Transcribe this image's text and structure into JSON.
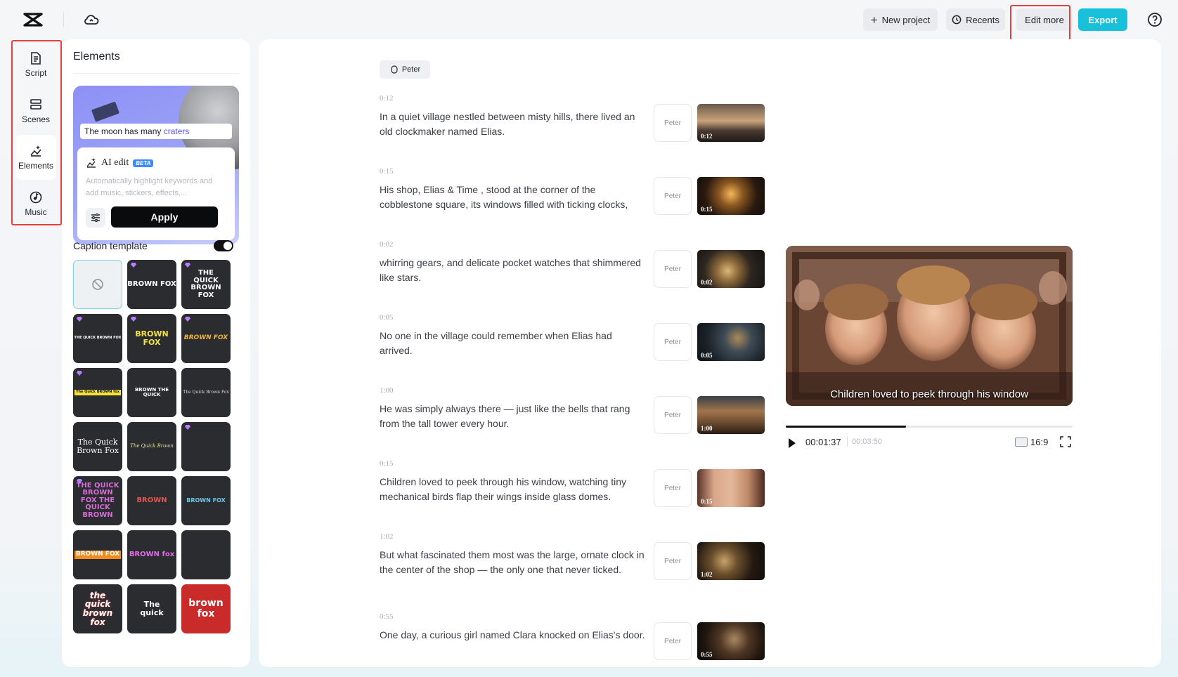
{
  "topbar": {
    "new_project": "New project",
    "recents": "Recents",
    "edit_more": "Edit more",
    "export": "Export"
  },
  "rail": {
    "items": [
      {
        "label": "Script",
        "icon": "script-icon"
      },
      {
        "label": "Scenes",
        "icon": "scenes-icon"
      },
      {
        "label": "Elements",
        "icon": "elements-icon",
        "active": true
      },
      {
        "label": "Music",
        "icon": "music-icon"
      }
    ]
  },
  "panel": {
    "title": "Elements",
    "ai_card": {
      "sample_caption_prefix": "The moon has many",
      "sample_caption_keyword": "craters",
      "ai_edit_label": "AI edit",
      "beta_badge": "BETA",
      "description": "Automatically highlight keywords and add music, stickers, effects,...",
      "apply": "Apply"
    },
    "caption_template": {
      "title": "Caption template",
      "enabled": true,
      "templates": [
        {
          "text": ""
        },
        {
          "text": "BROWN FOX"
        },
        {
          "text": "THE QUICK BROWN FOX"
        },
        {
          "text": "THE QUICK BROWN FOX"
        },
        {
          "text": "BROWN FOX"
        },
        {
          "text": "BROWN FOX"
        },
        {
          "text": "The Quick BROWN fox"
        },
        {
          "text": "BROWN THE QUICK"
        },
        {
          "text": "The Quick Brown Fox"
        },
        {
          "text": "The Quick Brown Fox"
        },
        {
          "text": "The Quick Brown"
        },
        {
          "text": ""
        },
        {
          "text": "THE QUICK BROWN FOX THE QUICK BROWN"
        },
        {
          "text": "BROWN"
        },
        {
          "text": "BROWN FOX"
        },
        {
          "text": "BROWN FOX"
        },
        {
          "text": "BROWN fox"
        },
        {
          "text": ""
        },
        {
          "text": "the quick brown fox"
        },
        {
          "text": "The quick"
        },
        {
          "text": "brown fox"
        }
      ]
    }
  },
  "script": {
    "speaker": "Peter",
    "segments": [
      {
        "time": "0:12",
        "text": "In a quiet village nestled between misty hills, there lived an old clockmaker named Elias.",
        "voice": "Peter",
        "duration": "0:12"
      },
      {
        "time": "0:15",
        "text": "His shop, Elias & Time , stood at the corner of the cobblestone square, its windows filled with ticking clocks,",
        "voice": "Peter",
        "duration": "0:15"
      },
      {
        "time": "0:02",
        "text": "whirring gears, and delicate pocket watches that shimmered like stars.",
        "voice": "Peter",
        "duration": "0:02"
      },
      {
        "time": "0:05",
        "text": "No one in the village could remember when Elias had arrived.",
        "voice": "Peter",
        "duration": "0:05"
      },
      {
        "time": "1:00",
        "text": "He was simply always there — just like the bells that rang from the tall tower every hour.",
        "voice": "Peter",
        "duration": "1:00"
      },
      {
        "time": "0:15",
        "text": "Children loved to peek through his window, watching tiny mechanical birds flap their wings inside glass domes.",
        "voice": "Peter",
        "duration": "0:15"
      },
      {
        "time": "1:02",
        "text": "But what fascinated them most was the large, ornate clock in the center of the shop — the only one that never ticked.",
        "voice": "Peter",
        "duration": "1:02"
      },
      {
        "time": "0:55",
        "text": "One day, a curious girl named Clara knocked on Elias's door.",
        "voice": "Peter",
        "duration": "0:55"
      }
    ]
  },
  "preview": {
    "caption": "Children loved to peek through his window",
    "current_time": "00:01:37",
    "total_time": "00:03:50",
    "progress": 0.42,
    "aspect_ratio": "16:9"
  },
  "colors": {
    "accent": "#18c1d9",
    "highlight_frame": "#e2413f",
    "apply_button": "#0a0b0d"
  }
}
